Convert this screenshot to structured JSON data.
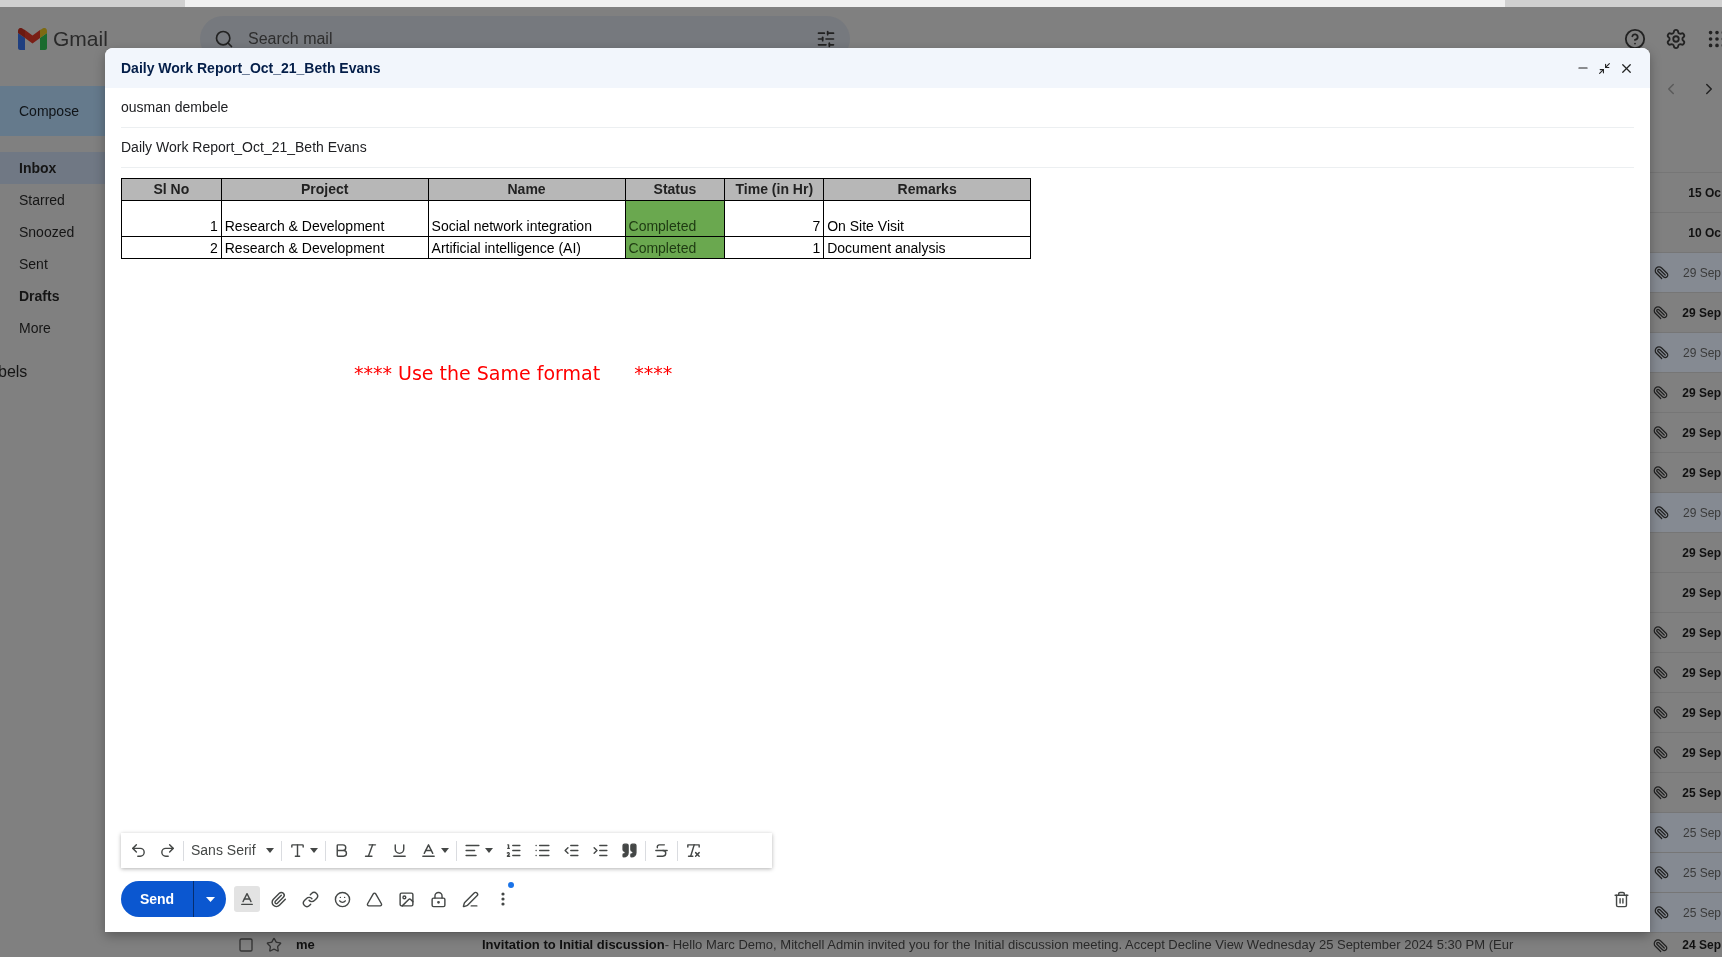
{
  "gmail": {
    "logo": "Gmail",
    "search": {
      "placeholder": "Search mail"
    },
    "compose_button": "Compose",
    "nav": [
      {
        "label": "Inbox",
        "selected": true,
        "unread": true
      },
      {
        "label": "Starred",
        "selected": false,
        "unread": false
      },
      {
        "label": "Snoozed",
        "selected": false,
        "unread": false
      },
      {
        "label": "Sent",
        "selected": false,
        "unread": false
      },
      {
        "label": "Drafts",
        "selected": false,
        "unread": true
      },
      {
        "label": "More",
        "selected": false,
        "unread": false
      }
    ],
    "labels_heading": "bels",
    "rows": [
      {
        "date": "15 Oc",
        "unread": true,
        "attachment": false
      },
      {
        "date": "10 Oc",
        "unread": true,
        "attachment": false
      },
      {
        "date": "29 Sep",
        "unread": false,
        "attachment": true
      },
      {
        "date": "29 Sep",
        "unread": true,
        "attachment": true
      },
      {
        "date": "29 Sep",
        "unread": false,
        "attachment": true
      },
      {
        "date": "29 Sep",
        "unread": true,
        "attachment": true
      },
      {
        "date": "29 Sep",
        "unread": true,
        "attachment": true
      },
      {
        "date": "29 Sep",
        "unread": true,
        "attachment": true
      },
      {
        "date": "29 Sep",
        "unread": false,
        "attachment": true
      },
      {
        "date": "29 Sep",
        "unread": true,
        "attachment": false
      },
      {
        "date": "29 Sep",
        "unread": true,
        "attachment": false
      },
      {
        "date": "29 Sep",
        "unread": true,
        "attachment": true
      },
      {
        "date": "29 Sep",
        "unread": true,
        "attachment": true
      },
      {
        "date": "29 Sep",
        "unread": true,
        "attachment": true
      },
      {
        "date": "29 Sep",
        "unread": true,
        "attachment": true
      },
      {
        "date": "25 Sep",
        "unread": true,
        "attachment": true
      },
      {
        "date": "25 Sep",
        "unread": false,
        "attachment": true
      },
      {
        "date": "25 Sep",
        "unread": false,
        "attachment": true
      },
      {
        "date": "25 Sep",
        "unread": false,
        "attachment": true
      },
      {
        "sender": "me",
        "subject": "Invitation to Initial discussion",
        "snippet": " - Hello Marc Demo, Mitchell Admin invited you for the Initial discussion meeting. Accept Decline View Wednesday 25 September 2024 5:30 PM (Eur",
        "date": "24 Sep",
        "unread": true,
        "attachment": true
      }
    ]
  },
  "compose": {
    "title": "Daily Work Report_Oct_21_Beth Evans",
    "to": "ousman dembele",
    "subject": "Daily Work Report_Oct_21_Beth Evans",
    "table": {
      "columns": [
        {
          "label": "Sl No",
          "kind": "number"
        },
        {
          "label": "Project",
          "kind": "text"
        },
        {
          "label": "Name",
          "kind": "text"
        },
        {
          "label": "Status",
          "kind": "status"
        },
        {
          "label": "Time (in Hr)",
          "kind": "number"
        },
        {
          "label": "Remarks",
          "kind": "text"
        }
      ],
      "rows": [
        {
          "cells": [
            "1",
            "Research & Development",
            "Social network integration",
            "Completed",
            "7",
            "On Site Visit"
          ]
        },
        {
          "cells": [
            "2",
            "Research & Development",
            "Artificial intelligence (AI)",
            "Completed",
            "1",
            "Document analysis"
          ]
        }
      ]
    },
    "note": [
      "**** Use the Same format",
      "****"
    ],
    "toolbar": {
      "font": "Sans Serif"
    },
    "send": "Send"
  }
}
